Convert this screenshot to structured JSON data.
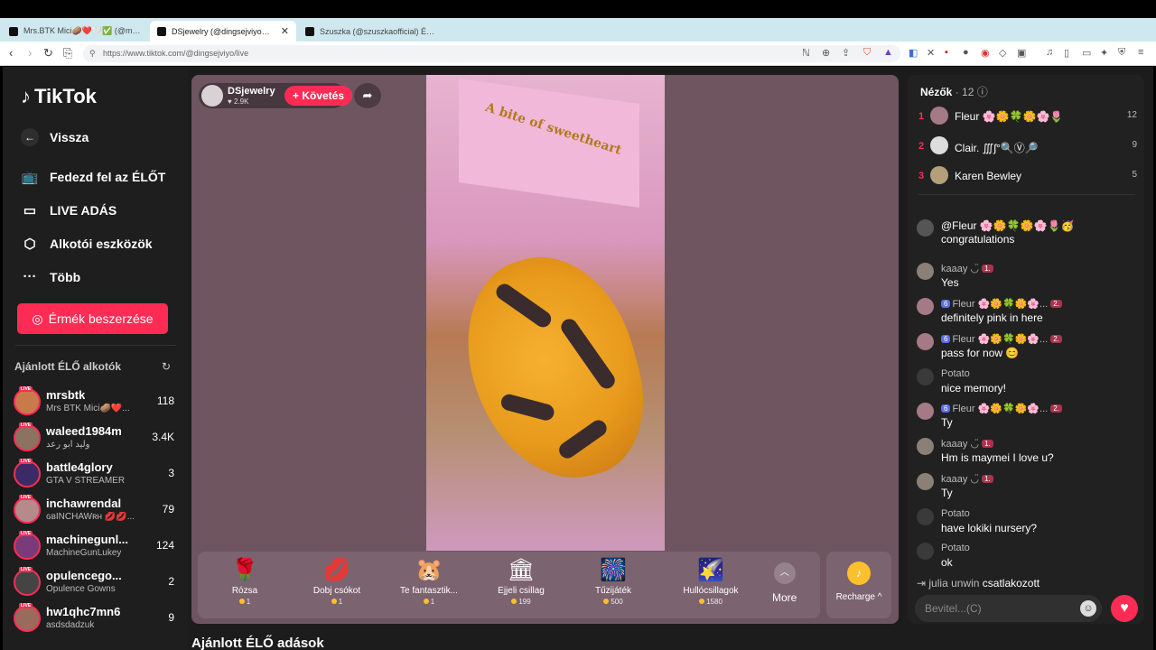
{
  "browser": {
    "tabs": [
      {
        "title": "Mrs.BTK Mici🥔❤️🤍✅ (@mrsbtk) "
      },
      {
        "title": "DSjewelry (@dingsejviyo) ÉLŐ"
      },
      {
        "title": "Szuszka (@szuszkaofficial) ÉLŐ adás"
      }
    ],
    "url": "https://www.tiktok.com/@dingsejviyo/live"
  },
  "sidebar": {
    "logo": "TikTok",
    "back": "Vissza",
    "nav": [
      {
        "label": "Fedezd fel az ÉLŐT"
      },
      {
        "label": "LIVE ADÁS"
      },
      {
        "label": "Alkotói eszközök"
      },
      {
        "label": "Több"
      }
    ],
    "coins_button": "Érmék beszerzése",
    "suggested_title": "Ajánlott ÉLŐ alkotók",
    "creators": [
      {
        "name": "mrsbtk",
        "sub": "Mrs BTK Mici🥔❤️...",
        "count": "118"
      },
      {
        "name": "waleed1984m",
        "sub": "وليد ابو رعد",
        "count": "3.4K"
      },
      {
        "name": "battle4glory",
        "sub": "GTA V STREAMER",
        "count": "3"
      },
      {
        "name": "inchawrendal",
        "sub": "ɢʙINCHAWʀʜ 💋💋...",
        "count": "79"
      },
      {
        "name": "machinegunl...",
        "sub": "MachineGunLukey",
        "count": "124"
      },
      {
        "name": "opulencego...",
        "sub": "Opulence Gowns",
        "count": "2"
      },
      {
        "name": "hw1qhc7mn6",
        "sub": "asdsdadzuk",
        "count": "9"
      }
    ],
    "live_badge": "LIVE"
  },
  "stream": {
    "streamer_name": "DSjewelry",
    "likes": "2.9K",
    "follow_label": "+ Követés",
    "box_text": "A bite of sweetheart"
  },
  "gifts": [
    {
      "name": "Rózsa",
      "price": "1",
      "icon": "🌹"
    },
    {
      "name": "Dobj csókot",
      "price": "1",
      "icon": "💋"
    },
    {
      "name": "Te fantasztik...",
      "price": "1",
      "icon": "🐹"
    },
    {
      "name": "Éjjeli csillag",
      "price": "199",
      "icon": "🏛"
    },
    {
      "name": "Tűzijáték",
      "price": "500",
      "icon": "🎆"
    },
    {
      "name": "Hullócsillagok",
      "price": "1580",
      "icon": "🌠"
    }
  ],
  "more_label": "More",
  "recharge_label": "Recharge ^",
  "below_title": "Ajánlott ÉLŐ adások",
  "chat": {
    "viewers_label": "Nézők",
    "viewers_count": "· 12",
    "top": [
      {
        "rank": "1",
        "name": "Fleur 🌸🌼🍀🌼🌸🌷",
        "score": "12"
      },
      {
        "rank": "2",
        "name": "Clair. ∭ʃ°🔍Ⓥ🔎",
        "score": "9"
      },
      {
        "rank": "3",
        "name": "Karen Bewley",
        "score": "5"
      }
    ],
    "messages": [
      {
        "user": "@Fleur 🌸🌼🍀🌼🌸🌷🥳",
        "text": "congratulations",
        "badges": []
      },
      {
        "user": "kaaay ◡̈",
        "text": "Yes",
        "badges": [
          "1."
        ]
      },
      {
        "user": "Fleur 🌸🌼🍀🌼🌸...",
        "text": "definitely pink in here",
        "badges": [
          "6",
          "2."
        ]
      },
      {
        "user": "Fleur 🌸🌼🍀🌼🌸...",
        "text": "pass for now 😊",
        "badges": [
          "6",
          "2."
        ]
      },
      {
        "user": "Potato",
        "text": "nice memory!",
        "badges": []
      },
      {
        "user": "Fleur 🌸🌼🍀🌼🌸...",
        "text": "Ty",
        "badges": [
          "6",
          "2."
        ]
      },
      {
        "user": "kaaay ◡̈",
        "text": "Hm is maymei I love u?",
        "badges": [
          "1."
        ]
      },
      {
        "user": "kaaay ◡̈",
        "text": "Ty",
        "badges": [
          "1."
        ]
      },
      {
        "user": "Potato",
        "text": "have lokiki nursery?",
        "badges": []
      },
      {
        "user": "Potato",
        "text": "ok",
        "badges": []
      }
    ],
    "joined_user": "julia unwin",
    "joined_text": "csatlakozott",
    "input_placeholder": "Bevitel...(C)"
  }
}
